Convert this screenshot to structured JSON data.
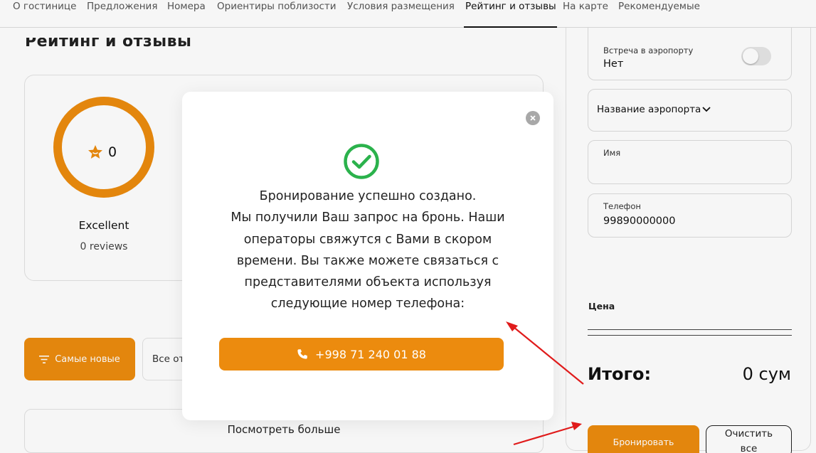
{
  "nav": {
    "tabs": [
      {
        "label": "О гостинице"
      },
      {
        "label": "Предложения"
      },
      {
        "label": "Номера"
      },
      {
        "label": "Ориентиры поблизости"
      },
      {
        "label": "Условия размещения"
      },
      {
        "label": "Рейтинг и отзывы",
        "active": true
      },
      {
        "label": "На карте"
      },
      {
        "label": "Рекомендуемые"
      }
    ]
  },
  "reviews": {
    "title": "Рейтинг и отзывы",
    "score": "0",
    "rating_label": "Excellent",
    "reviews_count": "0 reviews",
    "sort_label": "Самые новые",
    "filter_value": "Все от",
    "more_label": "Посмотреть больше"
  },
  "booking": {
    "airport_meeting_label": "Встреча в аэропорту",
    "airport_meeting_value": "Нет",
    "airport_name_placeholder": "Название аэропорта",
    "name_label": "Имя",
    "name_value": "",
    "phone_label": "Телефон",
    "phone_value": "99890000000",
    "price_label": "Цена",
    "total_label": "Итого:",
    "total_value": "0 сум",
    "book_label": "Бронировать",
    "clear_label": "Очистить все"
  },
  "modal": {
    "lines": [
      "Бронирование успешно создано.",
      "Мы получили Ваш запрос на бронь. Наши",
      "операторы свяжутся с Вами в скором",
      "времени. Вы также можете связаться с",
      "представителями объекта используя",
      "следующие номер телефона:"
    ],
    "phone_label": "+998 71 240 01 88"
  },
  "colors": {
    "accent": "#ec8b0e",
    "success": "#2bb24c",
    "arrow": "#e01b1b"
  },
  "icons": {
    "close": "close-icon",
    "success": "check-circle-icon",
    "phone": "phone-icon",
    "star": "star-icon",
    "sort": "sort-lines-icon",
    "chevron": "chevron-down-icon"
  }
}
